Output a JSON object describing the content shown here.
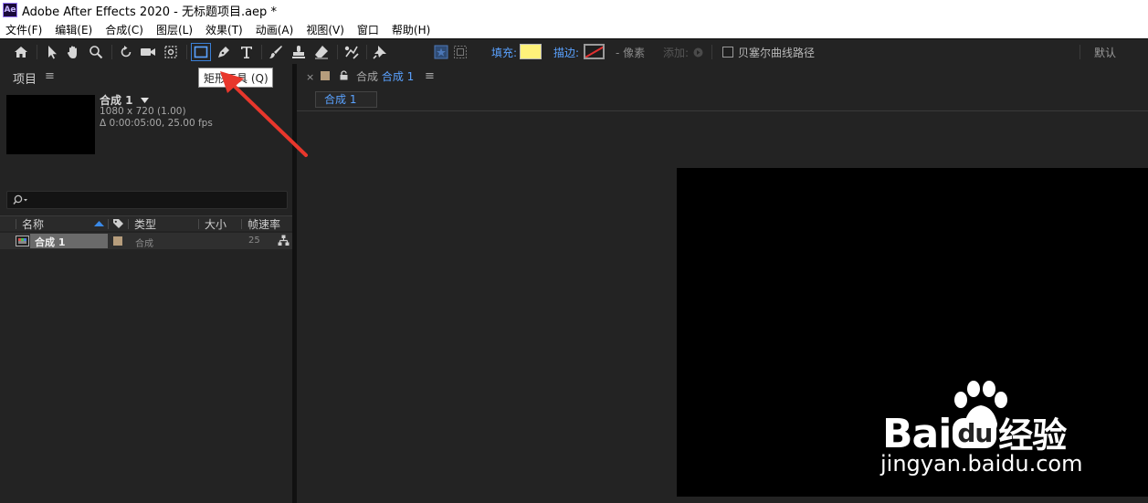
{
  "window": {
    "app_icon": "Ae",
    "title": "Adobe After Effects 2020 - 无标题项目.aep *"
  },
  "menu": [
    "文件(F)",
    "编辑(E)",
    "合成(C)",
    "图层(L)",
    "效果(T)",
    "动画(A)",
    "视图(V)",
    "窗口",
    "帮助(H)"
  ],
  "toolbar": {
    "fill_label": "填充:",
    "stroke_label": "描边:",
    "stroke_units": "- 像素",
    "add_label": "添加:",
    "bezier_label": "贝塞尔曲线路径",
    "workspace": "默认",
    "fill_color": "#fff27a",
    "stroke_color": "none"
  },
  "tooltip": {
    "text": "矩形工具 (Q)"
  },
  "project_panel": {
    "title": "项目",
    "comp_name": "合成 1",
    "comp_size": "1080 x 720 (1.00)",
    "comp_duration": "Δ 0:00:05:00, 25.00 fps",
    "columns": {
      "name": "名称",
      "type": "类型",
      "size": "大小",
      "fps": "帧速率"
    },
    "items": [
      {
        "name": "合成 1",
        "type": "合成",
        "size": "",
        "fps": "25"
      }
    ]
  },
  "composition_panel": {
    "tab_prefix": "合成",
    "tab_name": "合成 1",
    "breadcrumb": "合成 1"
  },
  "watermark": {
    "brand_left": "Bai",
    "brand_mid": "du",
    "brand_right": "经验",
    "url": "jingyan.baidu.com"
  }
}
